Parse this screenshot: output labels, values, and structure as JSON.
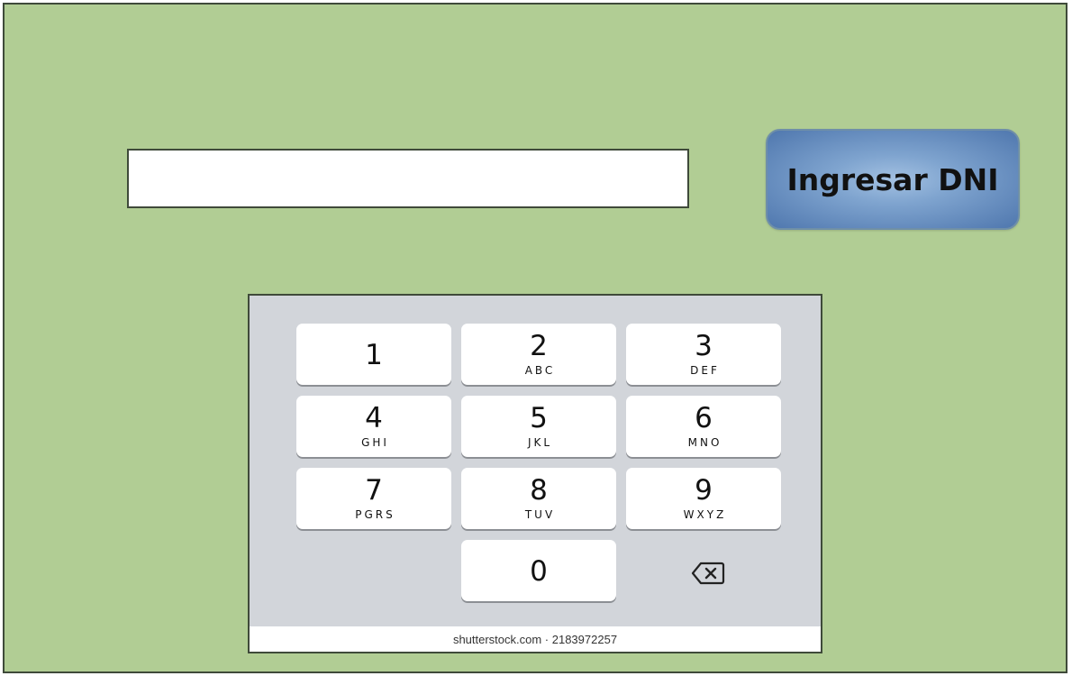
{
  "dni_input": {
    "value": "",
    "placeholder": ""
  },
  "submit_button": {
    "label": "Ingresar DNI"
  },
  "keypad": {
    "keys": [
      {
        "digit": "1",
        "letters": ""
      },
      {
        "digit": "2",
        "letters": "ABC"
      },
      {
        "digit": "3",
        "letters": "DEF"
      },
      {
        "digit": "4",
        "letters": "GHI"
      },
      {
        "digit": "5",
        "letters": "JKL"
      },
      {
        "digit": "6",
        "letters": "MNO"
      },
      {
        "digit": "7",
        "letters": "PGRS"
      },
      {
        "digit": "8",
        "letters": "TUV"
      },
      {
        "digit": "9",
        "letters": "WXYZ"
      },
      {
        "digit": "0",
        "letters": ""
      }
    ],
    "backspace_icon": "backspace-icon",
    "watermark": "shutterstock.com · 2183972257"
  },
  "colors": {
    "background": "#b1cd94",
    "button": "#5d84bb",
    "keypad": "#d2d5da"
  }
}
